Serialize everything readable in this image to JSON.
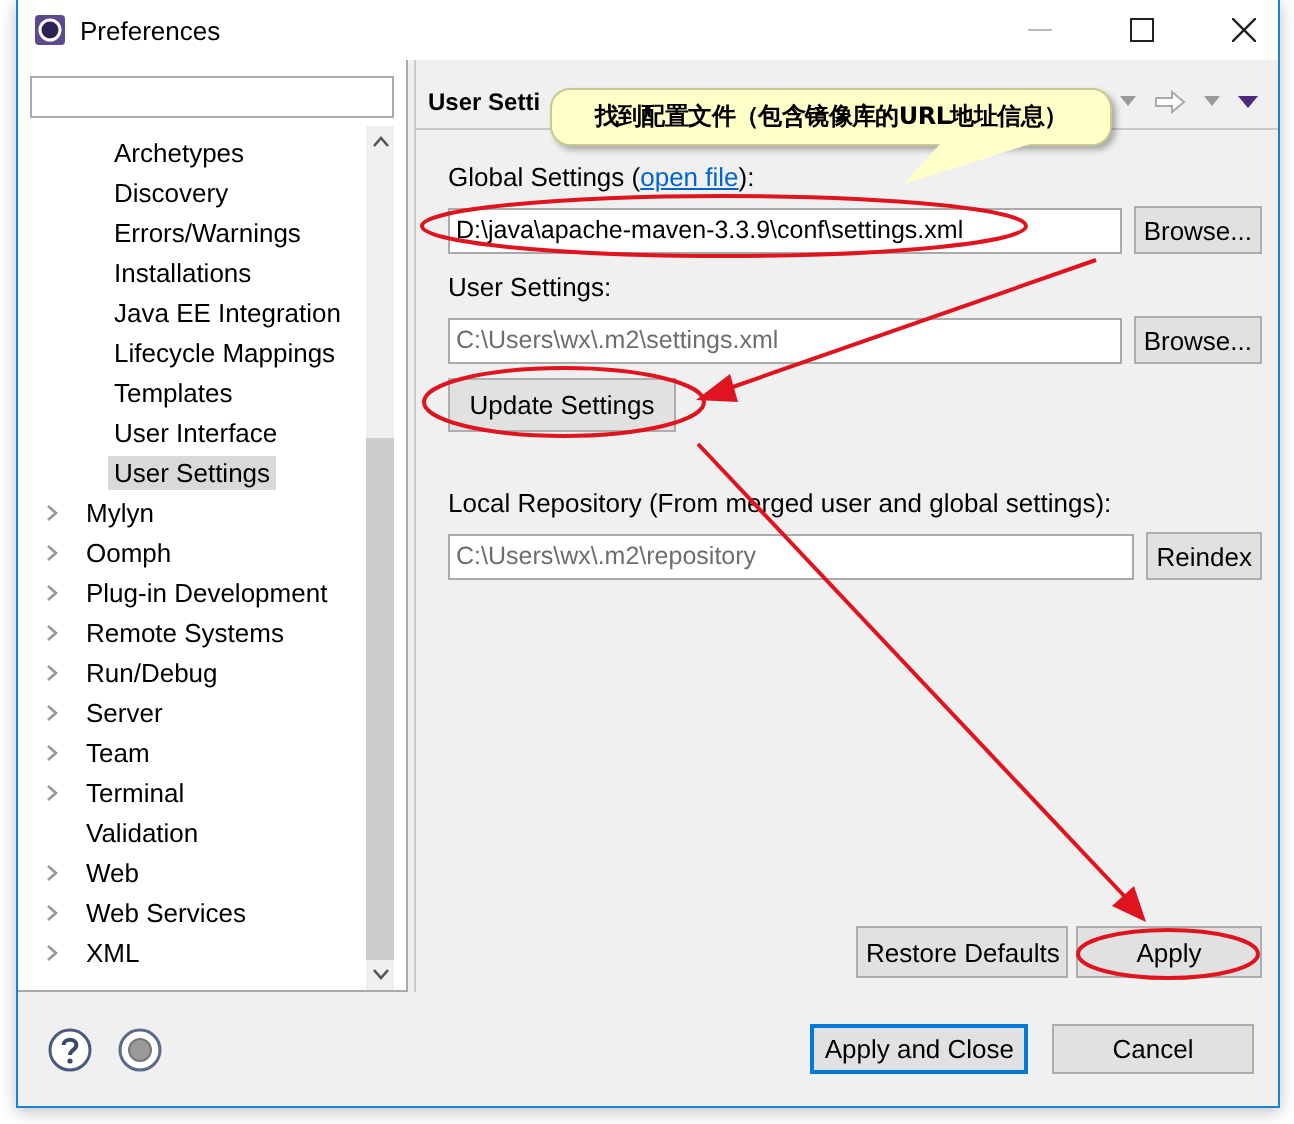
{
  "window": {
    "title": "Preferences"
  },
  "tree": {
    "nested_items": [
      {
        "label": "Archetypes",
        "selected": false
      },
      {
        "label": "Discovery",
        "selected": false
      },
      {
        "label": "Errors/Warnings",
        "selected": false
      },
      {
        "label": "Installations",
        "selected": false
      },
      {
        "label": "Java EE Integration",
        "selected": false
      },
      {
        "label": "Lifecycle Mappings",
        "selected": false
      },
      {
        "label": "Templates",
        "selected": false
      },
      {
        "label": "User Interface",
        "selected": false
      },
      {
        "label": "User Settings",
        "selected": true
      }
    ],
    "items": [
      {
        "label": "Mylyn",
        "expandable": true,
        "selected": false
      },
      {
        "label": "Oomph",
        "expandable": true,
        "selected": false
      },
      {
        "label": "Plug-in Development",
        "expandable": true,
        "selected": false
      },
      {
        "label": "Remote Systems",
        "expandable": true,
        "selected": false
      },
      {
        "label": "Run/Debug",
        "expandable": true,
        "selected": false
      },
      {
        "label": "Server",
        "expandable": true,
        "selected": false
      },
      {
        "label": "Team",
        "expandable": true,
        "selected": false
      },
      {
        "label": "Terminal",
        "expandable": true,
        "selected": false
      },
      {
        "label": "Validation",
        "expandable": false,
        "selected": false
      },
      {
        "label": "Web",
        "expandable": true,
        "selected": false
      },
      {
        "label": "Web Services",
        "expandable": true,
        "selected": false
      },
      {
        "label": "XML",
        "expandable": true,
        "selected": false
      }
    ]
  },
  "page": {
    "title": "User Setti",
    "global_settings": {
      "label_before": "Global Settings (",
      "link": "open file",
      "label_after": "):",
      "value": "D:\\java\\apache-maven-3.3.9\\conf\\settings.xml",
      "disabled": false,
      "button": "Browse..."
    },
    "user_settings": {
      "label": "User Settings:",
      "value": "C:\\Users\\wx\\.m2\\settings.xml",
      "disabled": true,
      "button": "Browse..."
    },
    "update_button": "Update Settings",
    "local_repository": {
      "label": "Local Repository (From merged user and global settings):",
      "value": "C:\\Users\\wx\\.m2\\repository",
      "disabled": true,
      "button": "Reindex"
    },
    "page_buttons": [
      "Restore Defaults",
      "Apply"
    ]
  },
  "dialog_buttons": [
    {
      "label": "Apply and Close",
      "default": true
    },
    {
      "label": "Cancel",
      "default": false
    }
  ],
  "callout": "找到配置文件（包含镜像库的URL地址信息）"
}
